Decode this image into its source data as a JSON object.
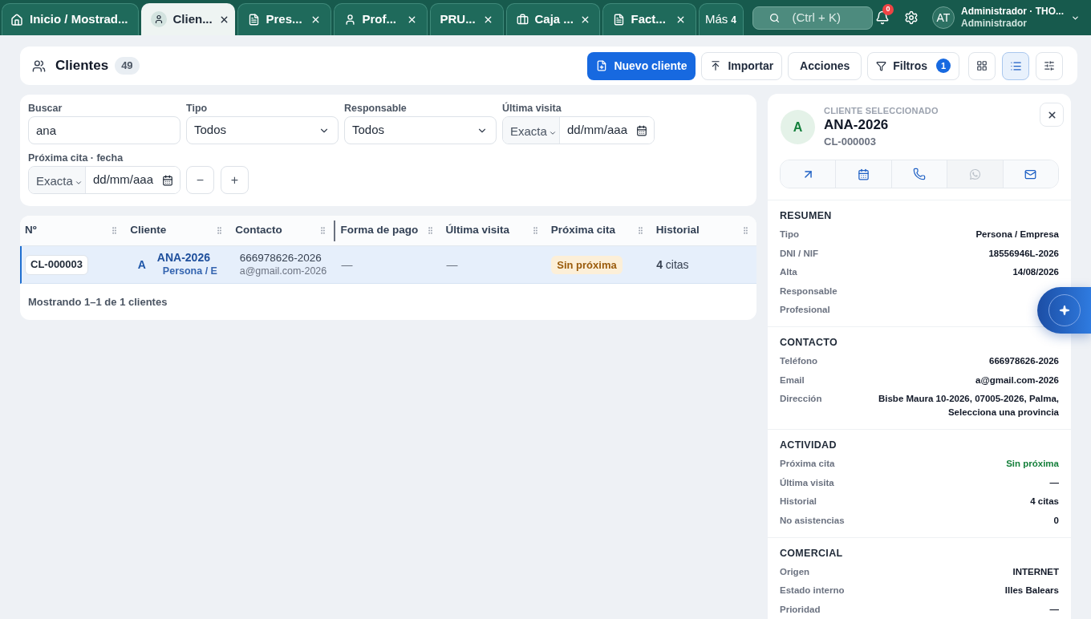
{
  "top_bar": {
    "tabs": [
      {
        "label": "Inicio / Mostrad...",
        "kind": "home",
        "selected": false,
        "closable": false
      },
      {
        "label": "Clien...",
        "kind": "person",
        "selected": true,
        "closable": true
      },
      {
        "label": "Pres...",
        "kind": "document",
        "selected": false,
        "closable": true
      },
      {
        "label": "Prof...",
        "kind": "person",
        "selected": false,
        "closable": true
      },
      {
        "label": "PRU...",
        "kind": "plain",
        "selected": false,
        "closable": true
      },
      {
        "label": "Caja ...",
        "kind": "cash",
        "selected": false,
        "closable": true
      },
      {
        "label": "Fact...",
        "kind": "document",
        "selected": false,
        "closable": true
      }
    ],
    "more": {
      "label": "Más",
      "count": "4"
    },
    "search": {
      "placeholder": "(Ctrl + K)"
    },
    "notifications": {
      "badge": "0"
    },
    "user": {
      "initials": "AT",
      "name": "Administrador · THO...",
      "role": "Administrador"
    }
  },
  "header": {
    "title": "Clientes",
    "count": "49",
    "actions": [
      {
        "label": "Nuevo cliente",
        "kind": "primary"
      },
      {
        "label": "Importar",
        "kind": "import"
      },
      {
        "label": "Acciones",
        "kind": "plain"
      },
      {
        "label": "Filtros",
        "kind": "filter",
        "badge": "1"
      }
    ],
    "views": [
      {
        "kind": "grid",
        "selected": false
      },
      {
        "kind": "list",
        "selected": true
      }
    ]
  },
  "filters": {
    "fields": [
      {
        "label": "Buscar",
        "kind": "text",
        "value": "ana"
      },
      {
        "label": "Tipo",
        "kind": "select",
        "value": "Todos"
      },
      {
        "label": "Responsable",
        "kind": "select",
        "value": "Todos"
      },
      {
        "label": "Última visita",
        "kind": "date",
        "mode": "Exacta",
        "placeholder": "dd/mm/aaa"
      },
      {
        "label": "Próxima cita · fecha",
        "kind": "date",
        "mode": "Exacta",
        "placeholder": "dd/mm/aaa"
      }
    ],
    "stepper": [
      "−",
      "+"
    ]
  },
  "table": {
    "columns": [
      {
        "label": "Nº",
        "resizing": false
      },
      {
        "label": "Cliente",
        "resizing": false
      },
      {
        "label": "Contacto",
        "resizing": true
      },
      {
        "label": "Forma de pago",
        "resizing": false
      },
      {
        "label": "Última visita",
        "resizing": false
      },
      {
        "label": "Próxima cita",
        "resizing": false
      },
      {
        "label": "Historial",
        "resizing": false
      }
    ],
    "rows": [
      {
        "selected": true,
        "code": "CL-000003",
        "initial": "A",
        "name": "ANA-2026",
        "type": "Persona / E",
        "phone": "666978626-2026",
        "email": "a@gmail.com-2026",
        "payment": "—",
        "last_visit": "—",
        "next_appointment": "Sin próxima",
        "history": "**4** citas"
      }
    ],
    "footer": "Mostrando 1–1 de 1 clientes"
  },
  "detail_panel": {
    "eyebrow": "CLIENTE SELECCIONADO",
    "initial": "A",
    "name": "ANA-2026",
    "code": "CL-000003",
    "actions": [
      {
        "kind": "open",
        "disabled": false
      },
      {
        "kind": "calendar",
        "disabled": false
      },
      {
        "kind": "phone",
        "disabled": false
      },
      {
        "kind": "chat",
        "disabled": true
      },
      {
        "kind": "mail",
        "disabled": false
      }
    ],
    "sections": [
      {
        "title": "RESUMEN",
        "rows": [
          {
            "label": "Tipo",
            "value": "Persona / Empresa"
          },
          {
            "label": "DNI / NIF",
            "value": "18556946L-2026"
          },
          {
            "label": "Alta",
            "value": "14/08/2026"
          },
          {
            "label": "Responsable"
          },
          {
            "label": "Profesional"
          }
        ]
      },
      {
        "title": "CONTACTO",
        "rows": [
          {
            "label": "Teléfono",
            "value": "666978626-2026"
          },
          {
            "label": "Email",
            "value": "a@gmail.com-2026"
          },
          {
            "label": "Dirección",
            "value": "Bisbe Maura 10-2026, 07005-2026, Palma, Selecciona una provincia"
          }
        ]
      },
      {
        "title": "ACTIVIDAD",
        "rows": [
          {
            "label": "Próxima cita",
            "value": "Sin próxima",
            "kind": "status"
          },
          {
            "label": "Última visita",
            "value": "—",
            "kind": "text"
          },
          {
            "label": "Historial",
            "value": "4 citas",
            "kind": "text"
          },
          {
            "label": "No asistencias",
            "value": "0",
            "kind": "text"
          }
        ]
      },
      {
        "title": "COMERCIAL",
        "rows": [
          {
            "label": "Origen",
            "value": "INTERNET"
          },
          {
            "label": "Estado interno",
            "value": "Illes Balears"
          },
          {
            "label": "Prioridad",
            "value": "—"
          }
        ]
      }
    ]
  }
}
